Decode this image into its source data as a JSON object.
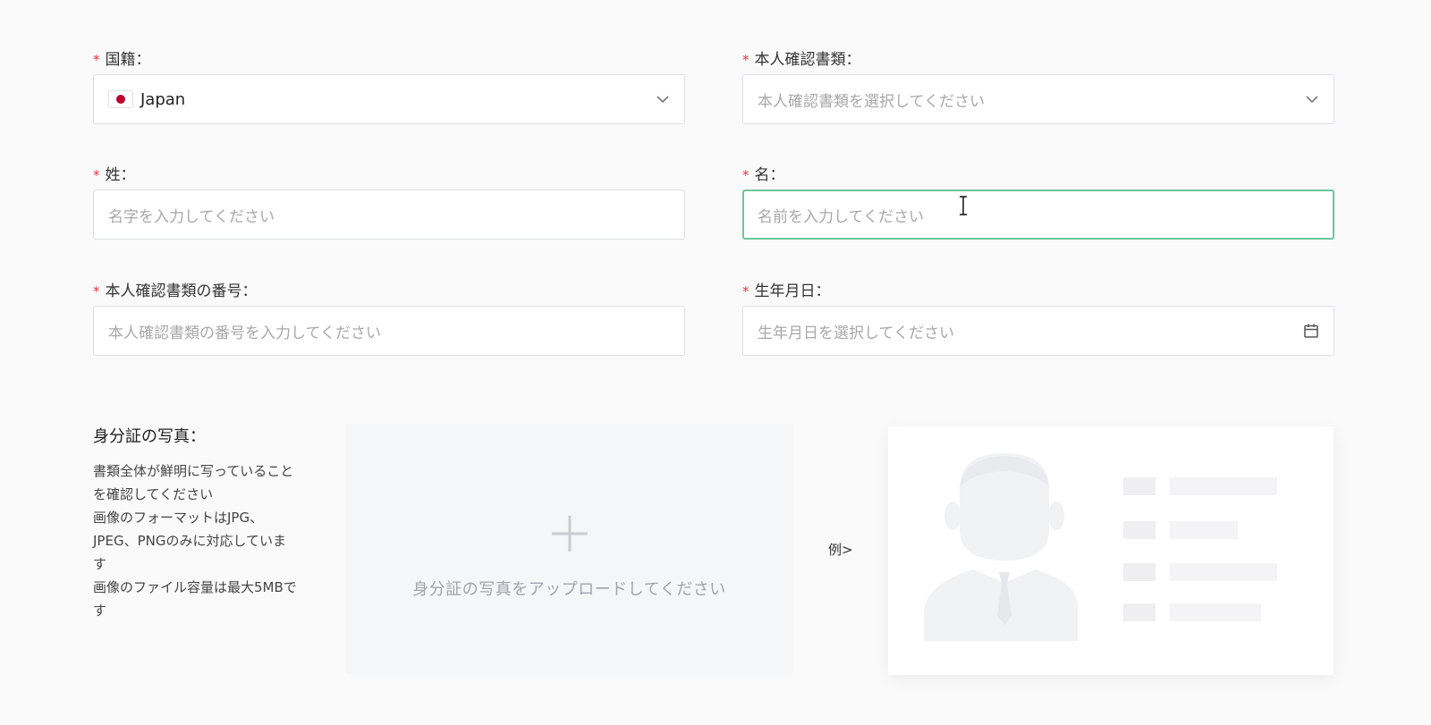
{
  "form": {
    "nationality": {
      "label": "国籍：",
      "value": "Japan",
      "flag_icon": "japan-flag-icon"
    },
    "id_document_type": {
      "label": "本人確認書類：",
      "placeholder": "本人確認書類を選択してください"
    },
    "last_name": {
      "label": "姓：",
      "placeholder": "名字を入力してください"
    },
    "first_name": {
      "label": "名：",
      "placeholder": "名前を入力してください"
    },
    "id_document_number": {
      "label": "本人確認書類の番号：",
      "placeholder": "本人確認書類の番号を入力してください"
    },
    "birth_date": {
      "label": "生年月日：",
      "placeholder": "生年月日を選択してください"
    },
    "required_mark": "*"
  },
  "id_photo": {
    "title": "身分証の写真：",
    "notes": [
      "書類全体が鮮明に写っていること",
      "を確認してください",
      "画像のフォーマットはJPG、",
      "JPEG、PNGのみに対応していま",
      "す",
      "画像のファイル容量は最大5MBで",
      "す"
    ],
    "upload_text": "身分証の写真をアップロードしてください",
    "example_label": "例>"
  },
  "colors": {
    "required": "#e0393e",
    "focus_border": "#6cc79a",
    "placeholder": "#a8a8a8",
    "upload_bg": "#f5f6f8"
  }
}
